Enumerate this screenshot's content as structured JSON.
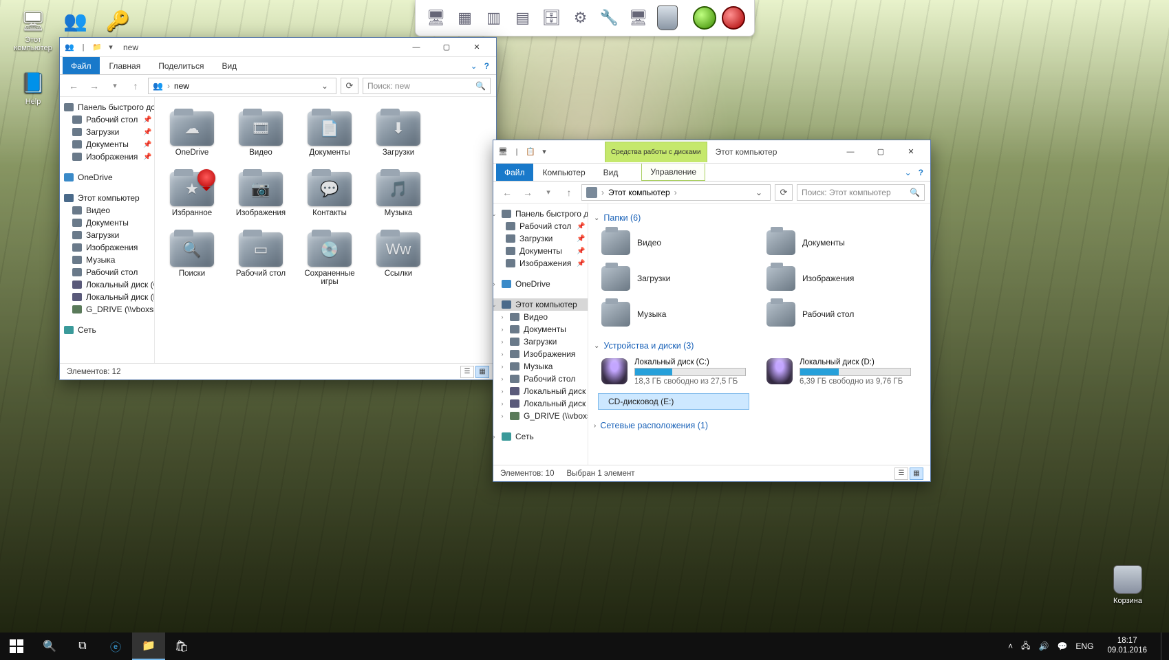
{
  "desktop": {
    "icons": [
      {
        "label": "Этот компьютер",
        "glyph": "🖥"
      },
      {
        "label": "Help",
        "glyph": "📘"
      }
    ],
    "contacts_glyph": "👥",
    "key_glyph": "🔑",
    "recycle": "Корзина"
  },
  "launcher": {
    "slots": [
      "🖥",
      "▦",
      "▥",
      "▤",
      "🗄",
      "⚙",
      "🔧",
      "🖥"
    ]
  },
  "win1": {
    "qat": [
      "👥",
      "|",
      "📁",
      "▾"
    ],
    "title": "new",
    "tabs": {
      "file": "Файл",
      "home": "Главная",
      "share": "Поделиться",
      "view": "Вид"
    },
    "crumb_icon": "👥",
    "crumb_text": "new",
    "search_placeholder": "Поиск: new",
    "nav": {
      "quick": "Панель быстрого доступа",
      "quick_items": [
        "Рабочий стол",
        "Загрузки",
        "Документы",
        "Изображения"
      ],
      "onedrive": "OneDrive",
      "thispc": "Этот компьютер",
      "pc_items": [
        "Видео",
        "Документы",
        "Загрузки",
        "Изображения",
        "Музыка",
        "Рабочий стол",
        "Локальный диск (C:)",
        "Локальный диск (D:)",
        "G_DRIVE (\\\\vboxsrv) (Z:)"
      ],
      "network": "Сеть"
    },
    "items": [
      {
        "label": "OneDrive",
        "glyph": "☁"
      },
      {
        "label": "Видео",
        "glyph": "🎞"
      },
      {
        "label": "Документы",
        "glyph": "📄"
      },
      {
        "label": "Загрузки",
        "glyph": "⬇"
      },
      {
        "label": "Избранное",
        "glyph": "★",
        "badge": true
      },
      {
        "label": "Изображения",
        "glyph": "📷"
      },
      {
        "label": "Контакты",
        "glyph": "💬"
      },
      {
        "label": "Музыка",
        "glyph": "🎵"
      },
      {
        "label": "Поиски",
        "glyph": "🔍"
      },
      {
        "label": "Рабочий стол",
        "glyph": "▭"
      },
      {
        "label": "Сохраненные игры",
        "glyph": "💿"
      },
      {
        "label": "Ссылки",
        "glyph": "Ww"
      }
    ],
    "status": "Элементов: 12"
  },
  "win2": {
    "qat": [
      "🖥",
      "|",
      "📋",
      "▾"
    ],
    "ctx_top": "Средства работы с дисками",
    "ctx_bottom": "Управление",
    "title": "Этот компьютер",
    "tabs": {
      "file": "Файл",
      "computer": "Компьютер",
      "view": "Вид"
    },
    "crumb_text": "Этот компьютер",
    "search_placeholder": "Поиск: Этот компьютер",
    "nav": {
      "quick": "Панель быстрого доступа",
      "quick_items": [
        "Рабочий стол",
        "Загрузки",
        "Документы",
        "Изображения"
      ],
      "onedrive": "OneDrive",
      "thispc": "Этот компьютер",
      "pc_items": [
        "Видео",
        "Документы",
        "Загрузки",
        "Изображения",
        "Музыка",
        "Рабочий стол",
        "Локальный диск (C:)",
        "Локальный диск (D:)",
        "G_DRIVE (\\\\vboxsrv) (Z:)"
      ],
      "network": "Сеть"
    },
    "folders_hdr": "Папки (6)",
    "folders": [
      "Видео",
      "Документы",
      "Загрузки",
      "Изображения",
      "Музыка",
      "Рабочий стол"
    ],
    "drives_hdr": "Устройства и диски (3)",
    "drives": [
      {
        "name": "Локальный диск (C:)",
        "free": "18,3 ГБ свободно из 27,5 ГБ",
        "fill": 34
      },
      {
        "name": "Локальный диск (D:)",
        "free": "6,39 ГБ свободно из 9,76 ГБ",
        "fill": 35
      }
    ],
    "cd": "CD-дисковод (E:)",
    "net_hdr": "Сетевые расположения (1)",
    "status_left": "Элементов: 10",
    "status_sel": "Выбран 1 элемент"
  },
  "taskbar": {
    "lang": "ENG",
    "time": "18:17",
    "date": "09.01.2016"
  }
}
